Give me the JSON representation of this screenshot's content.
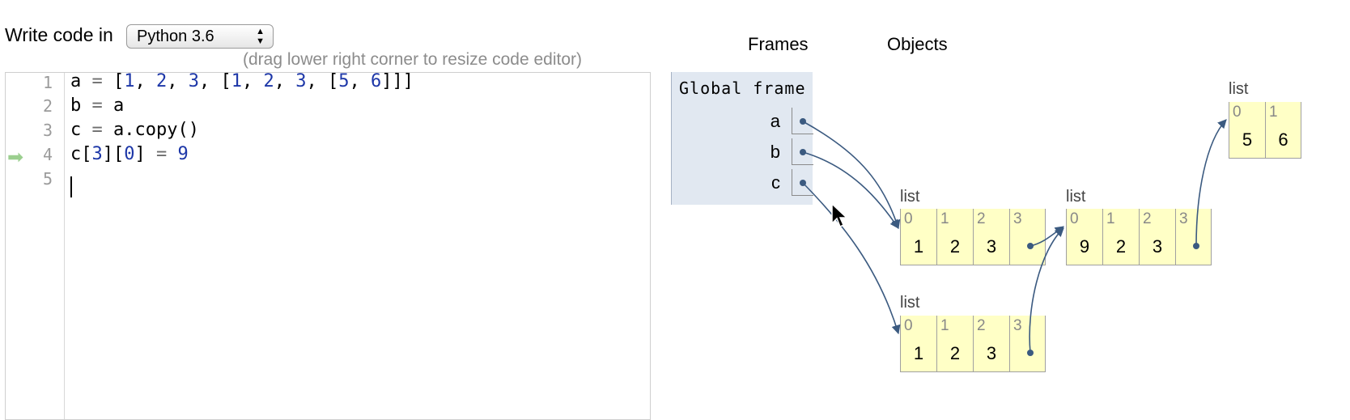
{
  "header": {
    "write_label": "Write code in",
    "language": "Python 3.6",
    "drag_hint": "(drag lower right corner to resize code editor)"
  },
  "editor": {
    "line_numbers": [
      "1",
      "2",
      "3",
      "4",
      "5"
    ],
    "current_line": 4,
    "lines": [
      "a = [1, 2, 3, [1, 2, 3, [5, 6]]]",
      "b = a",
      "c = a.copy()",
      "c[3][0] = 9",
      ""
    ]
  },
  "visualizer": {
    "frames_header": "Frames",
    "objects_header": "Objects",
    "global_frame": {
      "title": "Global frame",
      "vars": [
        "a",
        "b",
        "c"
      ]
    },
    "lists": {
      "outer_a": {
        "label": "list",
        "indices": [
          "0",
          "1",
          "2",
          "3"
        ],
        "values": [
          "1",
          "2",
          "3",
          ""
        ]
      },
      "copy_c": {
        "label": "list",
        "indices": [
          "0",
          "1",
          "2",
          "3"
        ],
        "values": [
          "1",
          "2",
          "3",
          ""
        ]
      },
      "inner": {
        "label": "list",
        "indices": [
          "0",
          "1",
          "2",
          "3"
        ],
        "values": [
          "9",
          "2",
          "3",
          ""
        ]
      },
      "innermost": {
        "label": "list",
        "indices": [
          "0",
          "1"
        ],
        "values": [
          "5",
          "6"
        ]
      }
    }
  },
  "colors": {
    "frame_bg": "#e1e8f1",
    "list_bg": "#ffffc6",
    "arrow": "#3b5a80",
    "number": "#1d37a8",
    "current_line_arrow": "#9bcf8f"
  }
}
